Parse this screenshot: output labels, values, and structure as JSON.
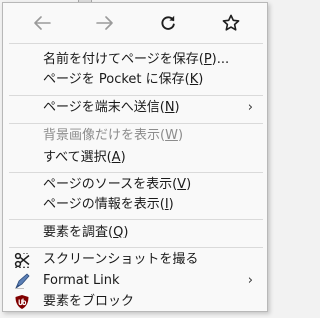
{
  "nav": {
    "back": "back-icon",
    "forward": "forward-icon",
    "reload": "reload-icon",
    "bookmark": "star-icon"
  },
  "items": {
    "save_page": {
      "label": "名前を付けてページを保存(",
      "key": "P",
      "suffix": ")..."
    },
    "save_pocket": {
      "label": "ページを Pocket に保存(",
      "key": "K",
      "suffix": ")"
    },
    "send_device": {
      "label": "ページを端末へ送信(",
      "key": "N",
      "suffix": ")",
      "arrow": "›"
    },
    "view_bg": {
      "label": "背景画像だけを表示(",
      "key": "W",
      "suffix": ")"
    },
    "select_all": {
      "label": "すべて選択(",
      "key": "A",
      "suffix": ")"
    },
    "view_source": {
      "label": "ページのソースを表示(",
      "key": "V",
      "suffix": ")"
    },
    "page_info": {
      "label": "ページの情報を表示(",
      "key": "I",
      "suffix": ")"
    },
    "inspect": {
      "label": "要素を調査(",
      "key": "Q",
      "suffix": ")"
    },
    "screenshot": {
      "label": "スクリーンショットを撮る",
      "icon": "scissors-icon"
    },
    "format_link": {
      "label": "Format Link",
      "icon": "format-link-icon",
      "arrow": "›"
    },
    "block_element": {
      "label": "要素をブロック",
      "icon": "ublock-icon"
    }
  },
  "colors": {
    "menu_bg": "#f9f9f9",
    "text": "#1a1a1a",
    "disabled_text": "#8c8c8c",
    "ublock_red": "#800000"
  }
}
